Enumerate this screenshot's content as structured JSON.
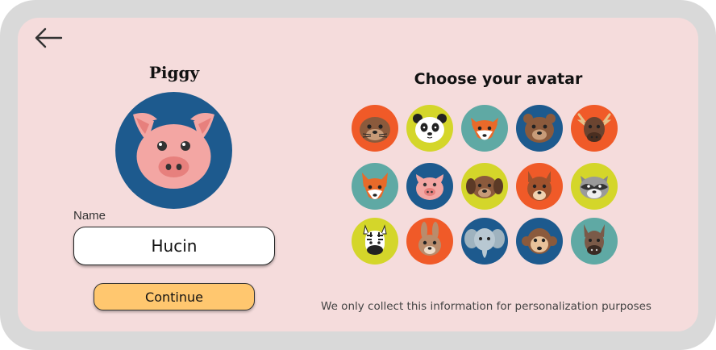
{
  "nav": {
    "back_icon": "arrow-left-icon"
  },
  "profile": {
    "selected_avatar_name": "Piggy",
    "name_label": "Name",
    "name_value": "Hucin",
    "continue_label": "Continue"
  },
  "chooser": {
    "title": "Choose your avatar",
    "note": "We only collect this information for personalization purposes",
    "avatars": [
      {
        "name": "otter",
        "bg": "#f05a28"
      },
      {
        "name": "panda",
        "bg": "#d4d62a"
      },
      {
        "name": "fox",
        "bg": "#5fa9a4"
      },
      {
        "name": "bear",
        "bg": "#1d5a8e"
      },
      {
        "name": "moose",
        "bg": "#f05a28"
      },
      {
        "name": "fox",
        "bg": "#5fa9a4"
      },
      {
        "name": "pig",
        "bg": "#1d5a8e"
      },
      {
        "name": "dog",
        "bg": "#d4d62a"
      },
      {
        "name": "squirrel",
        "bg": "#f05a28"
      },
      {
        "name": "raccoon",
        "bg": "#d4d62a"
      },
      {
        "name": "zebra",
        "bg": "#d4d62a"
      },
      {
        "name": "rabbit",
        "bg": "#f05a28"
      },
      {
        "name": "elephant",
        "bg": "#1d5a8e"
      },
      {
        "name": "monkey",
        "bg": "#1d5a8e"
      },
      {
        "name": "donkey",
        "bg": "#5fa9a4"
      }
    ]
  },
  "colors": {
    "frame": "#d9d9d9",
    "panel": "#f5dcdc",
    "button": "#ffc76f"
  }
}
